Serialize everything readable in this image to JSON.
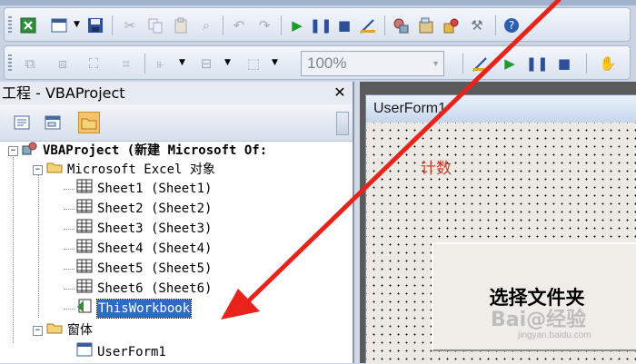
{
  "toolbar": {
    "zoom_value": "100%"
  },
  "project_pane": {
    "title": "工程 - VBAProject",
    "close_glyph": "✕"
  },
  "tree": {
    "root": "VBAProject (新建 Microsoft Of:",
    "excel_objects_folder": "Microsoft Excel 对象",
    "sheets": [
      "Sheet1 (Sheet1)",
      "Sheet2 (Sheet2)",
      "Sheet3 (Sheet3)",
      "Sheet4 (Sheet4)",
      "Sheet5 (Sheet5)",
      "Sheet6 (Sheet6)"
    ],
    "workbook": "ThisWorkbook",
    "forms_folder": "窗体",
    "forms": [
      "UserForm1"
    ]
  },
  "form_designer": {
    "form_title": "UserForm1",
    "label_text": "计数",
    "button_text": "选择文件夹"
  },
  "watermark": {
    "brand": "Bai@经验",
    "url": "jingyan.baidu.com"
  },
  "colors": {
    "arrow": "#e8231b",
    "selection": "#3169c6",
    "label_red": "#d83a2a"
  }
}
